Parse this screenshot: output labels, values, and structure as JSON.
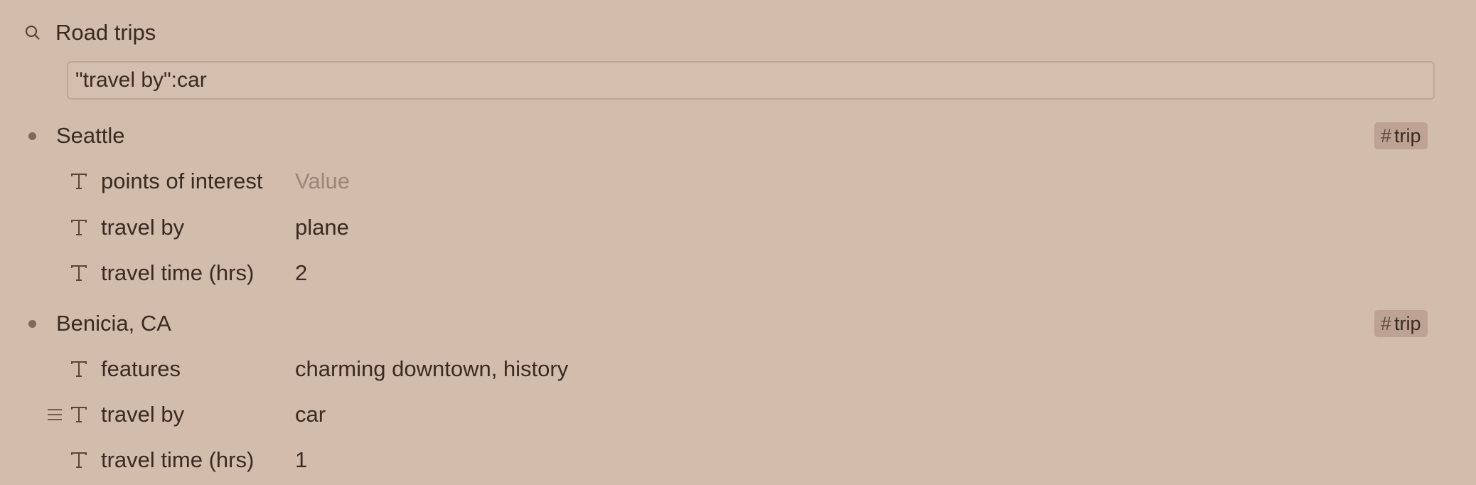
{
  "search": {
    "icon": "search-icon",
    "title": "Road trips",
    "query": "\"travel by\":car"
  },
  "results": [
    {
      "title": "Seattle",
      "tag": "trip",
      "fields": [
        {
          "icon": "text-type-icon",
          "name": "points of interest",
          "value": "",
          "placeholder": "Value"
        },
        {
          "icon": "text-type-icon",
          "name": "travel by",
          "value": "plane"
        },
        {
          "icon": "text-type-icon",
          "name": "travel time (hrs)",
          "value": "2"
        }
      ]
    },
    {
      "title": "Benicia, CA",
      "tag": "trip",
      "fields": [
        {
          "icon": "text-type-icon",
          "name": "features",
          "value": "charming downtown, history"
        },
        {
          "icon": "text-type-icon",
          "name": "travel by",
          "value": "car",
          "handle": "drag-handle-icon"
        },
        {
          "icon": "text-type-icon",
          "name": "travel time (hrs)",
          "value": "1"
        }
      ]
    }
  ],
  "colors": {
    "background": "#d2bcac",
    "text": "#3a2a20",
    "muted": "#9a8778",
    "tag_bg": "#bea294",
    "bullet": "#7e6a5c"
  }
}
